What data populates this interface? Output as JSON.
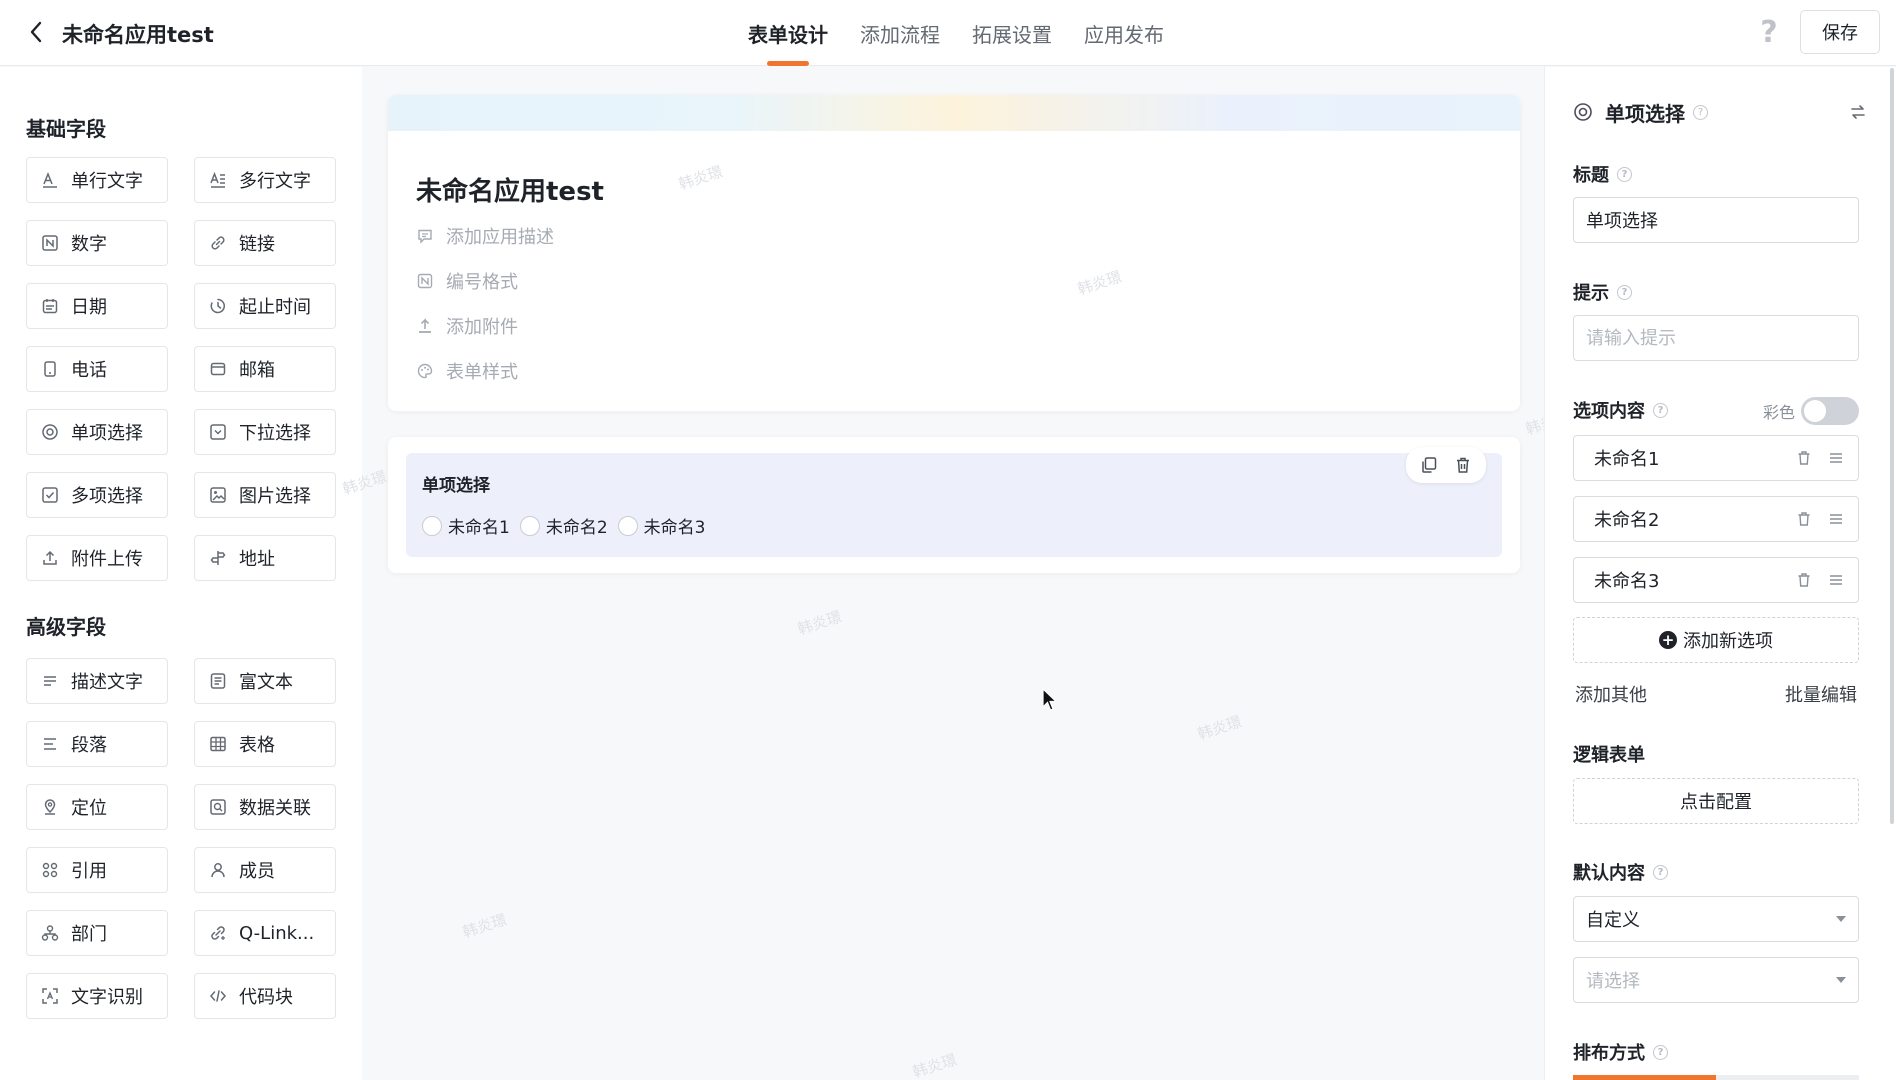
{
  "header": {
    "app_title": "未命名应用test",
    "tabs": [
      {
        "label": "表单设计",
        "active": true
      },
      {
        "label": "添加流程",
        "active": false
      },
      {
        "label": "拓展设置",
        "active": false
      },
      {
        "label": "应用发布",
        "active": false
      }
    ],
    "help_label": "?",
    "save_label": "保存",
    "accent_color": "#f0762f"
  },
  "left_panel": {
    "basic_title": "基础字段",
    "basic_fields": [
      {
        "label": "单行文字",
        "icon": "single-line-text-icon"
      },
      {
        "label": "多行文字",
        "icon": "multi-line-text-icon"
      },
      {
        "label": "数字",
        "icon": "number-icon"
      },
      {
        "label": "链接",
        "icon": "link-icon"
      },
      {
        "label": "日期",
        "icon": "calendar-icon"
      },
      {
        "label": "起止时间",
        "icon": "clock-icon"
      },
      {
        "label": "电话",
        "icon": "phone-icon"
      },
      {
        "label": "邮箱",
        "icon": "mail-icon"
      },
      {
        "label": "单项选择",
        "icon": "radio-icon"
      },
      {
        "label": "下拉选择",
        "icon": "dropdown-icon"
      },
      {
        "label": "多项选择",
        "icon": "checkbox-icon"
      },
      {
        "label": "图片选择",
        "icon": "image-icon"
      },
      {
        "label": "附件上传",
        "icon": "upload-icon"
      },
      {
        "label": "地址",
        "icon": "signpost-icon"
      }
    ],
    "advanced_title": "高级字段",
    "advanced_fields": [
      {
        "label": "描述文字",
        "icon": "description-icon"
      },
      {
        "label": "富文本",
        "icon": "rich-text-icon"
      },
      {
        "label": "段落",
        "icon": "paragraph-icon"
      },
      {
        "label": "表格",
        "icon": "table-icon"
      },
      {
        "label": "定位",
        "icon": "location-icon"
      },
      {
        "label": "数据关联",
        "icon": "data-link-icon"
      },
      {
        "label": "引用",
        "icon": "reference-icon"
      },
      {
        "label": "成员",
        "icon": "member-icon"
      },
      {
        "label": "部门",
        "icon": "department-icon"
      },
      {
        "label": "Q-Link...",
        "icon": "qlink-icon"
      },
      {
        "label": "文字识别",
        "icon": "ocr-icon"
      },
      {
        "label": "代码块",
        "icon": "code-icon"
      }
    ]
  },
  "canvas": {
    "form_title": "未命名应用test",
    "meta_items": [
      {
        "label": "添加应用描述",
        "icon": "comment-icon"
      },
      {
        "label": "编号格式",
        "icon": "number-format-icon"
      },
      {
        "label": "添加附件",
        "icon": "attachment-upload-icon"
      },
      {
        "label": "表单样式",
        "icon": "palette-icon"
      }
    ],
    "selected_field": {
      "label": "单项选择",
      "options": [
        "未命名1",
        "未命名2",
        "未命名3"
      ]
    },
    "watermark": "韩炎璟"
  },
  "right_panel": {
    "field_type": "单项选择",
    "title_label": "标题",
    "title_value": "单项选择",
    "hint_label": "提示",
    "hint_placeholder": "请输入提示",
    "options_label": "选项内容",
    "color_label": "彩色",
    "color_enabled": false,
    "options": [
      "未命名1",
      "未命名2",
      "未命名3"
    ],
    "add_option_label": "添加新选项",
    "add_other_label": "添加其他",
    "batch_edit_label": "批量编辑",
    "logic_form_label": "逻辑表单",
    "logic_config_label": "点击配置",
    "default_label": "默认内容",
    "default_mode": "自定义",
    "default_value_placeholder": "请选择",
    "layout_label": "排布方式"
  }
}
